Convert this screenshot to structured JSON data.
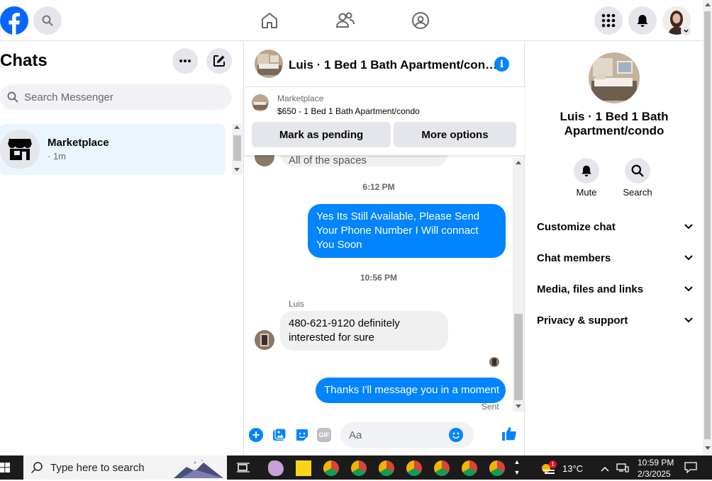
{
  "topbar": {
    "logo": "facebook-logo",
    "nav_icons": [
      "home-icon",
      "friends-icon",
      "groups-icon"
    ],
    "right_icons": [
      "menu-grid-icon",
      "notifications-icon",
      "profile-avatar"
    ]
  },
  "left": {
    "title": "Chats",
    "search_placeholder": "Search Messenger",
    "chat": {
      "name": "Marketplace",
      "meta": "· 1m"
    }
  },
  "header": {
    "title": "Luis · 1 Bed 1 Bath Apartment/con…"
  },
  "marketplace_card": {
    "source": "Marketplace",
    "listing": "$650 - 1 Bed 1 Bath Apartment/condo",
    "pending_label": "Mark as pending",
    "options_label": "More options"
  },
  "messages": {
    "partial_text": "All of the spaces",
    "time1": "6:12 PM",
    "out1": "Yes Its Still Available, Please Send Your Phone Number I Will connact You Soon",
    "time2": "10:56 PM",
    "sender": "Luis",
    "in1": "480-621-9120 definitely interested for sure",
    "out2": "Thanks I'll message you in a moment",
    "status": "Sent"
  },
  "composer": {
    "placeholder": "Aa"
  },
  "right": {
    "name": "Luis · 1 Bed 1 Bath Apartment/condo",
    "mute_label": "Mute",
    "search_label": "Search",
    "sections": [
      "Customize chat",
      "Chat members",
      "Media, files and links",
      "Privacy & support"
    ]
  },
  "taskbar": {
    "search_placeholder": "Type here to search",
    "temperature": "13°C",
    "time": "10:59 PM",
    "date": "2/3/2025",
    "weather_badge": "1"
  },
  "colors": {
    "accent": "#0084ff",
    "fb_blue": "#0866ff",
    "selected_chat": "#ebf5ff"
  }
}
